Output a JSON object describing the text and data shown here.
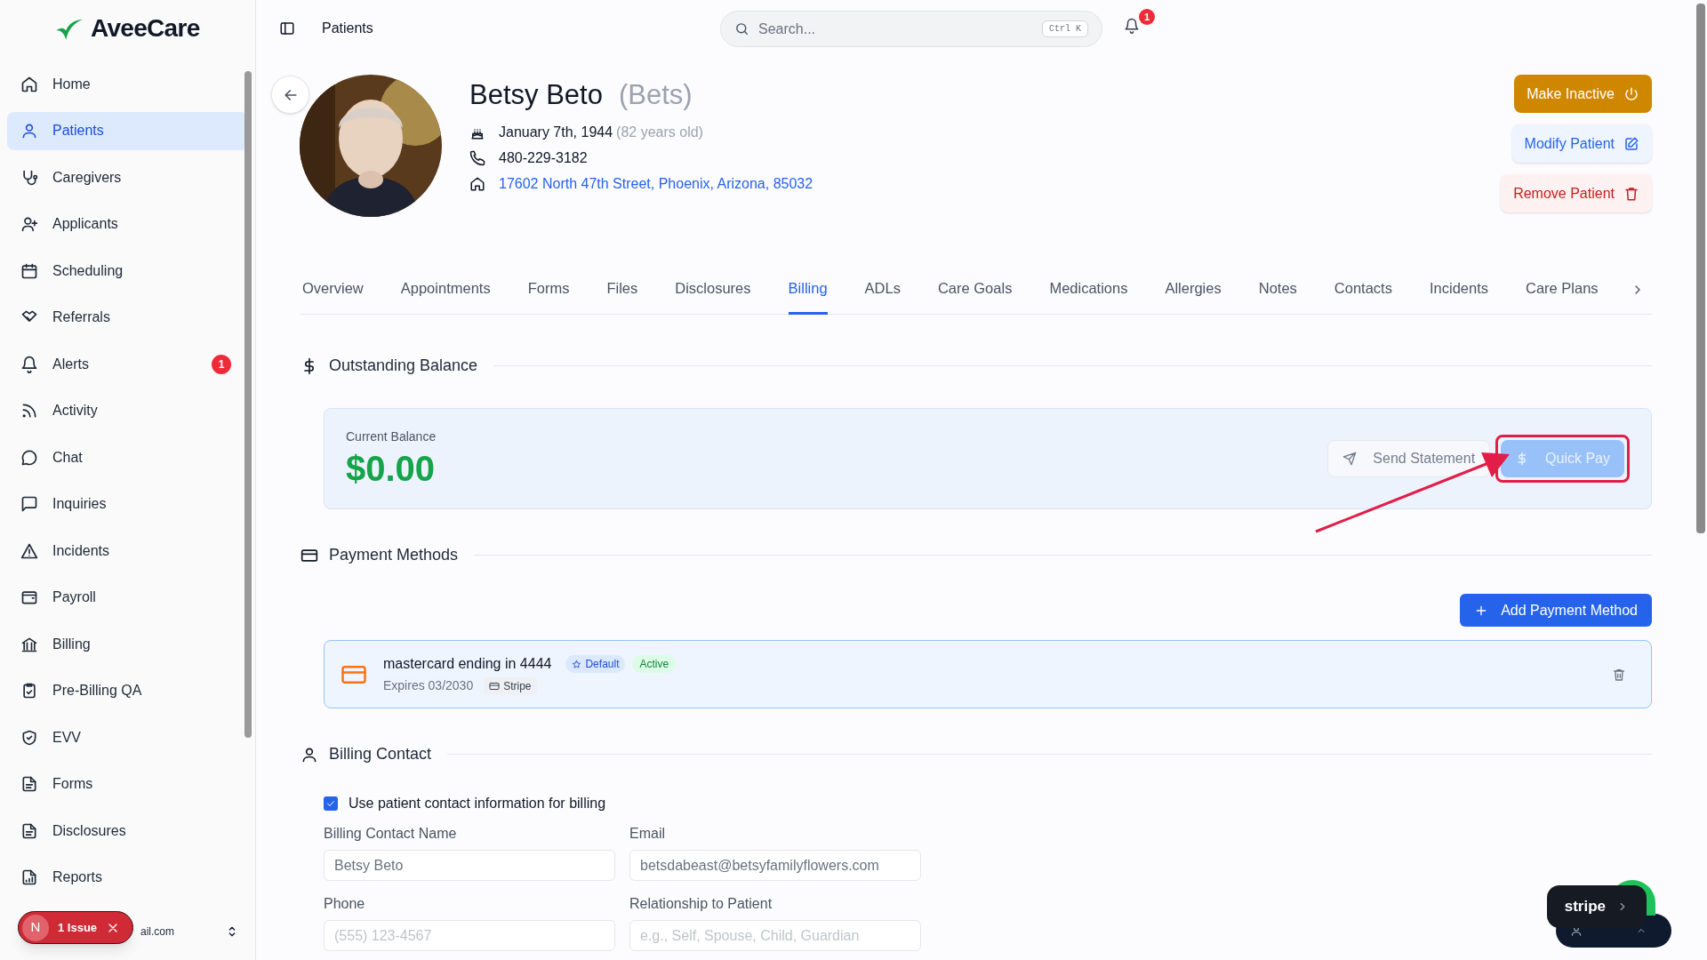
{
  "app": {
    "logo": "AveeCare"
  },
  "sidebar": {
    "items": [
      {
        "label": "Home",
        "selected": false
      },
      {
        "label": "Patients",
        "selected": true
      },
      {
        "label": "Caregivers",
        "selected": false
      },
      {
        "label": "Applicants",
        "selected": false
      },
      {
        "label": "Scheduling",
        "selected": false
      },
      {
        "label": "Referrals",
        "selected": false
      },
      {
        "label": "Alerts",
        "selected": false,
        "badge": "1"
      },
      {
        "label": "Activity",
        "selected": false
      },
      {
        "label": "Chat",
        "selected": false
      },
      {
        "label": "Inquiries",
        "selected": false
      },
      {
        "label": "Incidents",
        "selected": false
      },
      {
        "label": "Payroll",
        "selected": false
      },
      {
        "label": "Billing",
        "selected": false
      },
      {
        "label": "Pre-Billing QA",
        "selected": false
      },
      {
        "label": "EVV",
        "selected": false
      },
      {
        "label": "Forms",
        "selected": false
      },
      {
        "label": "Disclosures",
        "selected": false
      },
      {
        "label": "Reports",
        "selected": false
      }
    ],
    "account": "ail.com"
  },
  "issue_toast": {
    "avatar": "N",
    "label": "1 Issue"
  },
  "header": {
    "title": "Patients",
    "search": {
      "placeholder": "Search...",
      "shortcut": "Ctrl K"
    },
    "notifications": "1"
  },
  "patient": {
    "name": "Betsy Beto",
    "nickname": "(Bets)",
    "birthday": "January 7th, 1944",
    "age": "(82 years old)",
    "phone": "480-229-3182",
    "address": "17602 North 47th Street, Phoenix, Arizona, 85032"
  },
  "actions": [
    {
      "label": "Make Inactive",
      "kind": "warning"
    },
    {
      "label": "Modify Patient",
      "kind": "edit"
    },
    {
      "label": "Remove Patient",
      "kind": "danger"
    }
  ],
  "tabs": [
    {
      "label": "Overview",
      "selected": false
    },
    {
      "label": "Appointments",
      "selected": false
    },
    {
      "label": "Forms",
      "selected": false
    },
    {
      "label": "Files",
      "selected": false
    },
    {
      "label": "Disclosures",
      "selected": false
    },
    {
      "label": "Billing",
      "selected": true
    },
    {
      "label": "ADLs",
      "selected": false
    },
    {
      "label": "Care Goals",
      "selected": false
    },
    {
      "label": "Medications",
      "selected": false
    },
    {
      "label": "Allergies",
      "selected": false
    },
    {
      "label": "Notes",
      "selected": false
    },
    {
      "label": "Contacts",
      "selected": false
    },
    {
      "label": "Incidents",
      "selected": false
    },
    {
      "label": "Care Plans",
      "selected": false
    }
  ],
  "outstanding_balance": {
    "title": "Outstanding Balance",
    "label": "Current Balance",
    "amount": "$0.00",
    "buttons": [
      {
        "label": "Send Statement",
        "kind": "send",
        "disabled": true,
        "highlighted": false
      },
      {
        "label": "Quick Pay",
        "kind": "pay",
        "disabled": true,
        "highlighted": true
      }
    ]
  },
  "payment_methods": {
    "title": "Payment Methods",
    "add_button": "Add Payment Method",
    "methods": [
      {
        "name": "mastercard ending in 4444",
        "badge": "Default",
        "status": "Active",
        "expires": "Expires 03/2030",
        "processor": "Stripe"
      }
    ]
  },
  "billing_contact": {
    "title": "Billing Contact",
    "use_patient_info": {
      "label": "Use patient contact information for billing",
      "checked": true
    },
    "fields": [
      {
        "label": "Billing Contact Name",
        "value": "Betsy Beto",
        "disabled": true
      },
      {
        "label": "Email",
        "value": "betsdabeast@betsyfamilyflowers.com",
        "disabled": true
      },
      {
        "label": "Phone",
        "placeholder": "(555) 123-4567",
        "disabled": true
      },
      {
        "label": "Relationship to Patient",
        "placeholder": "e.g., Self, Spouse, Child, Guardian",
        "disabled": true
      }
    ]
  },
  "stripe_widget": {
    "label": "stripe"
  }
}
